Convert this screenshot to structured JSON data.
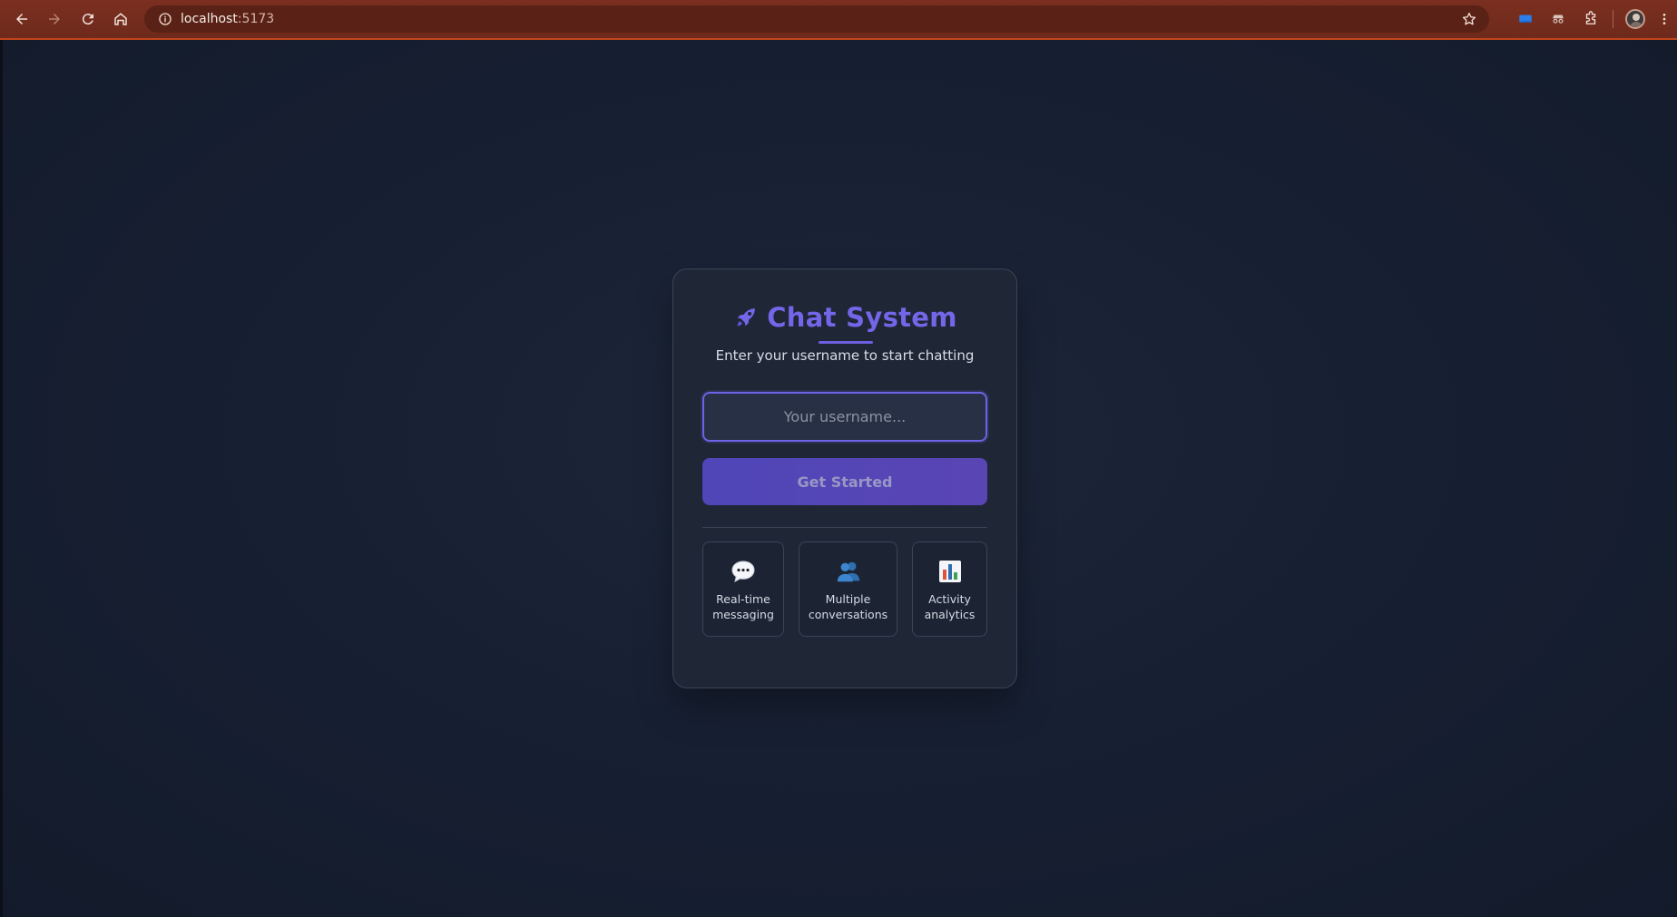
{
  "browser": {
    "url_host": "localhost",
    "url_port": ":5173"
  },
  "card": {
    "title": "Chat System",
    "subtitle": "Enter your username to start chatting",
    "username_placeholder": "Your username...",
    "get_started_label": "Get Started"
  },
  "features": [
    {
      "label": "Real-time\nmessaging",
      "icon": "speech-bubble-icon"
    },
    {
      "label": "Multiple\nconversations",
      "icon": "people-icon"
    },
    {
      "label": "Activity\nanalytics",
      "icon": "bar-chart-icon"
    }
  ],
  "colors": {
    "accent": "#7466e8",
    "button": "#4f46b8",
    "card_bg": "#1f2737",
    "page_bg": "#172033",
    "browser_bar": "#7a2f1f"
  }
}
